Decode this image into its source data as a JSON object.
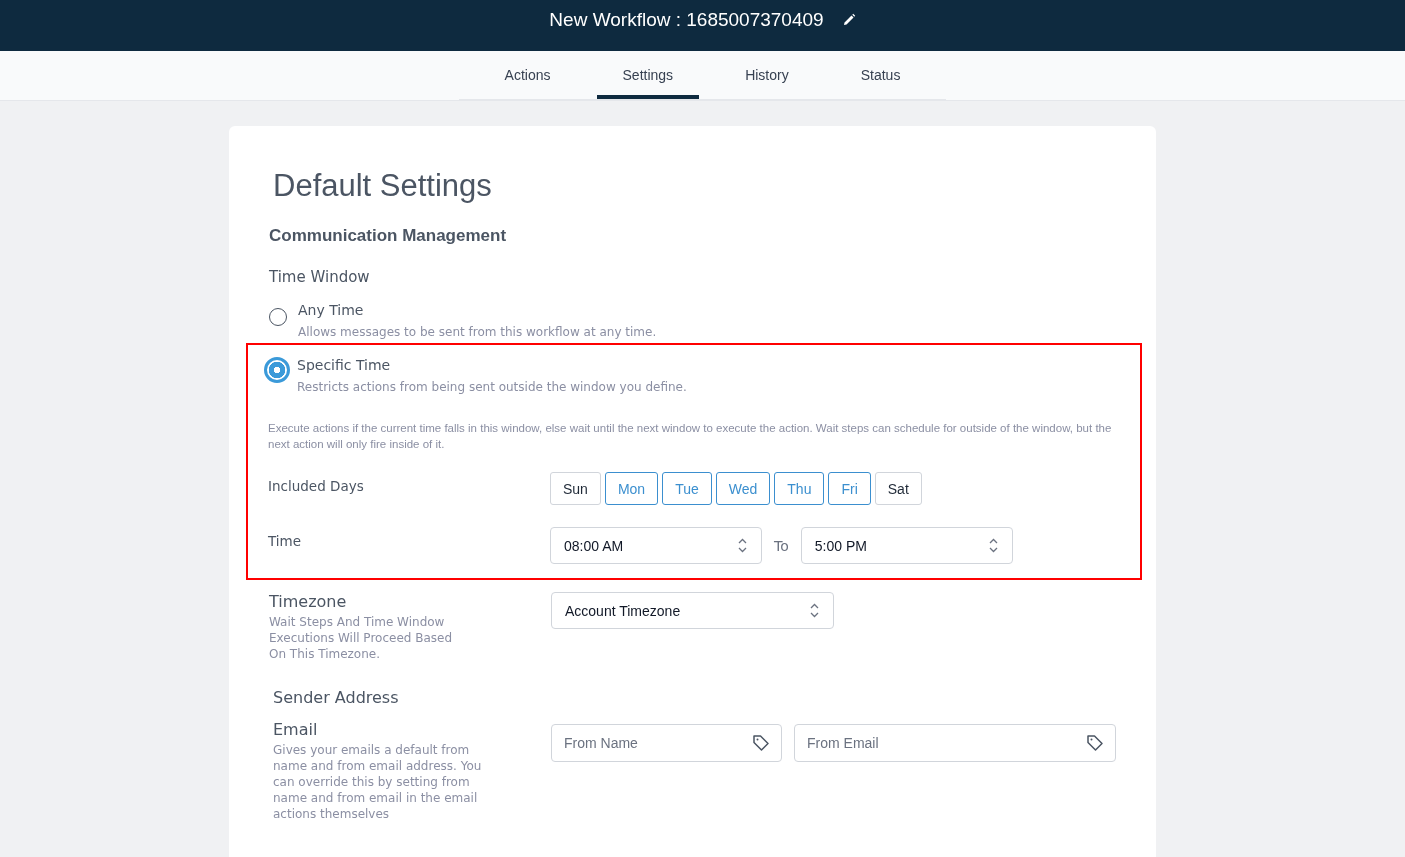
{
  "header": {
    "title": "New Workflow : 1685007370409"
  },
  "tabs": [
    {
      "label": "Actions",
      "selected": false
    },
    {
      "label": "Settings",
      "selected": true
    },
    {
      "label": "History",
      "selected": false
    },
    {
      "label": "Status",
      "selected": false
    }
  ],
  "page_title": "Default Settings",
  "section_title": "Communication Management",
  "time_window": {
    "label": "Time Window",
    "options": [
      {
        "label": "Any Time",
        "description": "Allows messages to be sent from this workflow at any time.",
        "selected": false
      },
      {
        "label": "Specific Time",
        "description": "Restricts actions from being sent outside the window you define.",
        "selected": true
      }
    ],
    "note": "Execute actions if the current time falls in this window, else wait until the next window to execute the action. Wait steps can schedule for outside of the window, but the next action will only fire inside of it.",
    "days_label": "Included Days",
    "days": [
      {
        "label": "Sun",
        "selected": false
      },
      {
        "label": "Mon",
        "selected": true
      },
      {
        "label": "Tue",
        "selected": true
      },
      {
        "label": "Wed",
        "selected": true
      },
      {
        "label": "Thu",
        "selected": true
      },
      {
        "label": "Fri",
        "selected": true
      },
      {
        "label": "Sat",
        "selected": false
      }
    ],
    "time_label": "Time",
    "from": "08:00 AM",
    "to_label": "To",
    "to": "5:00 PM"
  },
  "timezone": {
    "label": "Timezone",
    "description": "Wait Steps And Time Window Executions Will Proceed Based On This Timezone.",
    "value": "Account Timezone"
  },
  "sender": {
    "title": "Sender Address",
    "email_label": "Email",
    "description": "Gives your emails a default from name and from email address. You can override this by setting from name and from email in the email actions themselves",
    "from_name_placeholder": "From Name",
    "from_email_placeholder": "From Email"
  }
}
